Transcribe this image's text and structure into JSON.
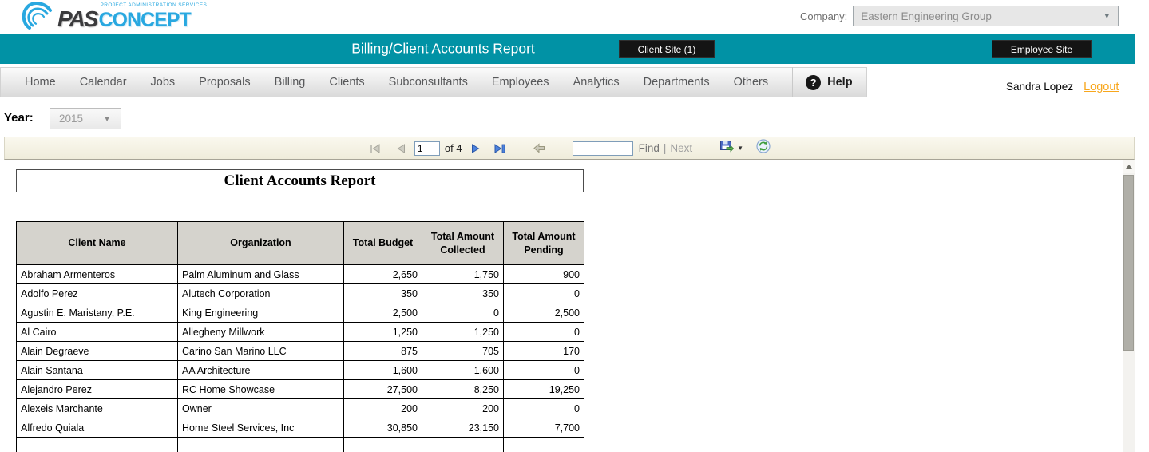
{
  "header": {
    "logo": {
      "pas": "PAS",
      "concept": "CONCEPT",
      "tagline": "PROJECT ADMINISTRATION SERVICES"
    },
    "company": {
      "label": "Company:",
      "value": "Eastern Engineering Group"
    }
  },
  "banner": {
    "title": "Billing/Client Accounts Report",
    "client_site": "Client Site (1)",
    "employee_site": "Employee Site"
  },
  "nav": {
    "items": [
      "Home",
      "Calendar",
      "Jobs",
      "Proposals",
      "Billing",
      "Clients",
      "Subconsultants",
      "Employees",
      "Analytics",
      "Departments",
      "Others"
    ],
    "help": "Help",
    "user": "Sandra Lopez",
    "logout": "Logout"
  },
  "filters": {
    "year_label": "Year:",
    "year_value": "2015"
  },
  "toolbar": {
    "page": "1",
    "of": "of 4",
    "search_value": "",
    "find": "Find",
    "sep": "|",
    "next": "Next"
  },
  "report": {
    "title": "Client Accounts Report",
    "columns": [
      "Client Name",
      "Organization",
      "Total Budget",
      "Total Amount Collected",
      "Total Amount Pending"
    ],
    "rows": [
      [
        "Abraham Armenteros",
        "Palm Aluminum and Glass",
        "2,650",
        "1,750",
        "900"
      ],
      [
        "Adolfo Perez",
        "Alutech Corporation",
        "350",
        "350",
        "0"
      ],
      [
        "Agustin E. Maristany, P.E.",
        "King Engineering",
        "2,500",
        "0",
        "2,500"
      ],
      [
        "Al Cairo",
        "Allegheny Millwork",
        "1,250",
        "1,250",
        "0"
      ],
      [
        "Alain Degraeve",
        "Carino San Marino LLC",
        "875",
        "705",
        "170"
      ],
      [
        "Alain Santana",
        "AA Architecture",
        "1,600",
        "1,600",
        "0"
      ],
      [
        "Alejandro Perez",
        "RC Home Showcase",
        "27,500",
        "8,250",
        "19,250"
      ],
      [
        "Alexeis Marchante",
        "Owner",
        "200",
        "200",
        "0"
      ],
      [
        "Alfredo Quiala",
        "Home Steel Services, Inc",
        "30,850",
        "23,150",
        "7,700"
      ]
    ],
    "partial_row": [
      "",
      "",
      "",
      "",
      ""
    ]
  },
  "icons": {
    "chevron_down": "▼",
    "help_question": "?",
    "export_caret": "▼"
  },
  "colors": {
    "teal": "#0192A5",
    "logo_blue": "#29A8E0",
    "logout_orange": "#F8A71D",
    "toolbar_cream": "#F5F2E3",
    "table_header_gray": "#D5D3CD",
    "site_button_black": "#141414"
  }
}
